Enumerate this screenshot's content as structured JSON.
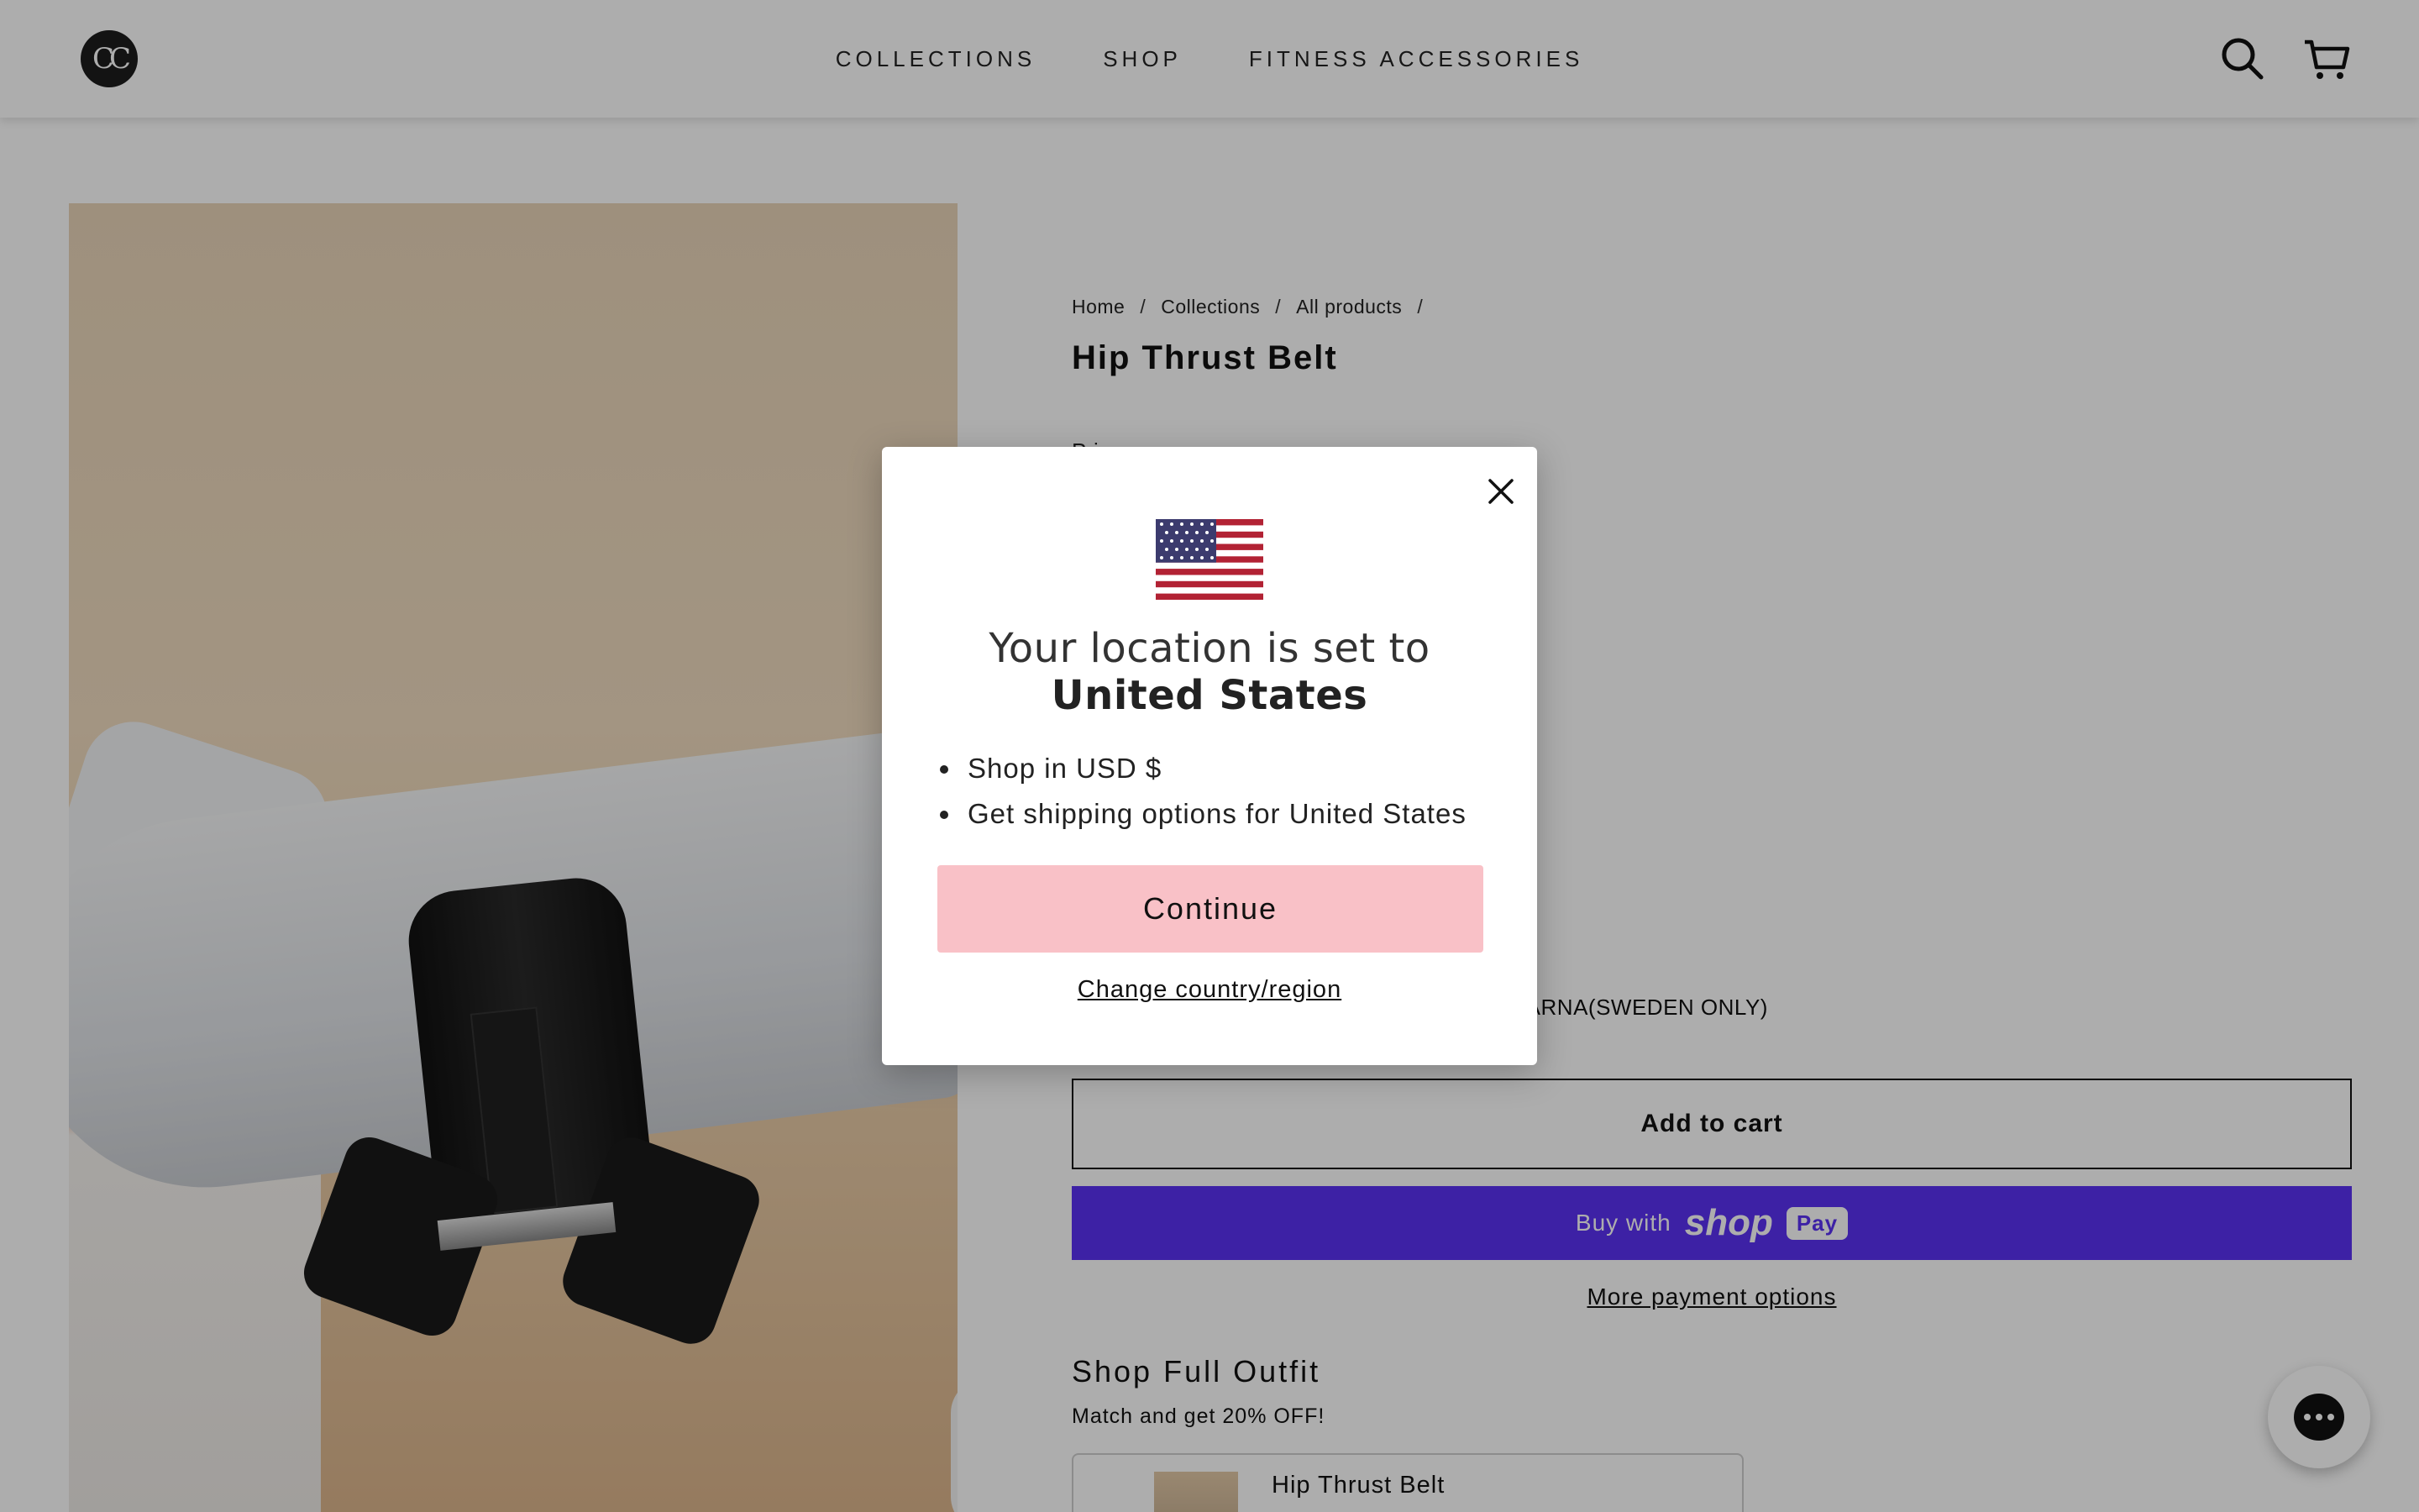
{
  "header": {
    "logo_text": "CC",
    "nav": [
      "COLLECTIONS",
      "SHOP",
      "FITNESS ACCESSORIES"
    ],
    "icons": [
      "search-icon",
      "cart-icon"
    ]
  },
  "breadcrumb": [
    "Home",
    "Collections",
    "All products"
  ],
  "breadcrumb_sep": "/",
  "product": {
    "title": "Hip Thrust Belt",
    "price_label": "Price",
    "payment_methods": "PAYPAL | APPLE PAY | CREDIT CARDS | KLARNA(SWEDEN ONLY)",
    "add_to_cart": "Add to cart",
    "buy_with": "Buy with",
    "shop_word": "shop",
    "pay_word": "Pay",
    "more_payment": "More payment options"
  },
  "outfit": {
    "title": "Shop Full Outfit",
    "subtitle": "Match and get 20% OFF!",
    "item_name": "Hip Thrust Belt"
  },
  "modal": {
    "heading_prefix": "Your location is set to",
    "heading_country": "United States",
    "bullets": [
      "Shop in USD $",
      "Get shipping options for United States"
    ],
    "continue": "Continue",
    "change": "Change country/region"
  },
  "colors": {
    "shop_pay": "#5a31f4",
    "continue_button": "#f9c1c7",
    "overlay": "rgba(0,0,0,0.32)"
  }
}
